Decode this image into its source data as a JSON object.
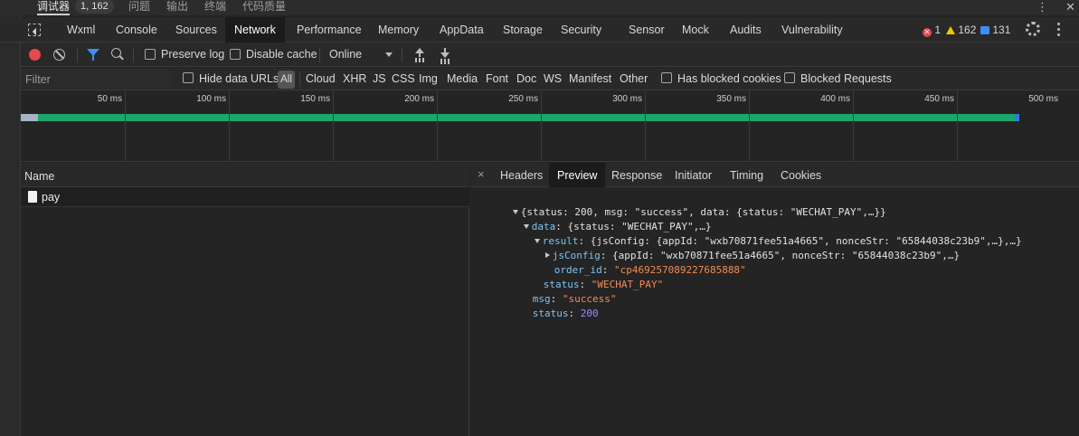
{
  "top_tabs": {
    "debugger": "调试器",
    "debugger_badge": "1, 162",
    "issues": "问题",
    "output": "输出",
    "terminal": "终端",
    "code_quality": "代码质量",
    "more": "⋮",
    "close": "✕"
  },
  "devtools_tabs": [
    "Wxml",
    "Console",
    "Sources",
    "Network",
    "Performance",
    "Memory",
    "AppData",
    "Storage",
    "Security",
    "Sensor",
    "Mock",
    "Audits",
    "Vulnerability"
  ],
  "active_devtools_tab": "Network",
  "counters": {
    "errors": "1",
    "warnings": "162",
    "messages": "131"
  },
  "toolbar": {
    "preserve_log": "Preserve log",
    "disable_cache": "Disable cache",
    "throttling": "Online"
  },
  "filter_bar": {
    "placeholder": "Filter",
    "hide_data_urls": "Hide data URLs",
    "all": "All",
    "types": [
      "Cloud",
      "XHR",
      "JS",
      "CSS",
      "Img",
      "Media",
      "Font",
      "Doc",
      "WS",
      "Manifest",
      "Other"
    ],
    "has_blocked_cookies": "Has blocked cookies",
    "blocked_requests": "Blocked Requests"
  },
  "timeline": {
    "ticks": [
      "50 ms",
      "100 ms",
      "150 ms",
      "200 ms",
      "250 ms",
      "300 ms",
      "350 ms",
      "400 ms",
      "450 ms",
      "500 ms"
    ],
    "request_total_ms": 480,
    "request_wait_ms": 7,
    "colors": {
      "waiting": "#a3b4c8",
      "download": "#1ea56b",
      "end": "#2f7de1"
    }
  },
  "requests": {
    "column_name": "Name",
    "rows": [
      {
        "name": "pay"
      }
    ]
  },
  "detail": {
    "close": "×",
    "tabs": [
      "Headers",
      "Preview",
      "Response",
      "Initiator",
      "Timing",
      "Cookies"
    ],
    "active_tab": "Preview",
    "preview": {
      "root_summary": "{status: 200, msg: \"success\", data: {status: \"WECHAT_PAY\",…}}",
      "data_key": "data",
      "data_summary": "{status: \"WECHAT_PAY\",…}",
      "result_key": "result",
      "result_summary": "{jsConfig: {appId: \"wxb70871fee51a4665\", nonceStr: \"65844038c23b9\",…},…}",
      "jsconfig_key": "jsConfig",
      "jsconfig_summary": "{appId: \"wxb70871fee51a4665\", nonceStr: \"65844038c23b9\",…}",
      "order_id_key": "order_id",
      "order_id_value": "\"cp469257089227685888\"",
      "inner_status_key": "status",
      "inner_status_value": "\"WECHAT_PAY\"",
      "msg_key": "msg",
      "msg_value": "\"success\"",
      "status_key": "status",
      "status_value": "200"
    }
  }
}
